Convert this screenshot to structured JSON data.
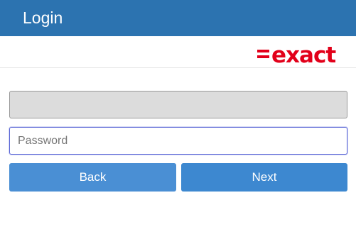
{
  "header": {
    "title": "Login",
    "background": "#2c73b0"
  },
  "brand": {
    "logo_text": "=exact",
    "color": "#e2001a"
  },
  "form": {
    "username": {
      "value": "",
      "placeholder": ""
    },
    "password": {
      "value": "",
      "placeholder": "Password"
    },
    "back_label": "Back",
    "next_label": "Next"
  }
}
